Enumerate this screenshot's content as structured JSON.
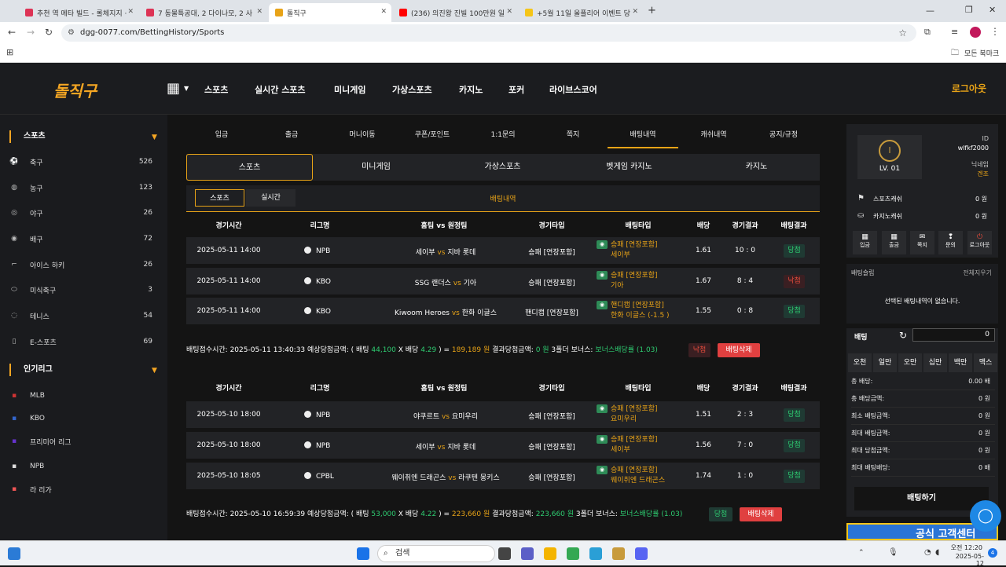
{
  "browser": {
    "tabs": [
      {
        "title": "추천 역 메타 빌드 - 롤체지지 ·",
        "color": "#d35"
      },
      {
        "title": "7 동물특공대, 2 다이나모, 2 사",
        "color": "#d35"
      },
      {
        "title": "돌직구",
        "color": "#e8a317"
      },
      {
        "title": "(236) 의진왕 진빌 100만원 일",
        "color": "#f00"
      },
      {
        "title": "+5월 11일 올플리어 이벤트 당",
        "color": "#f5c518"
      }
    ],
    "new_tab": "+",
    "url": "dgg-0077.com/BettingHistory/Sports",
    "bookmarks_label": "모든 북마크"
  },
  "site": {
    "logo": "돌직구",
    "nav": [
      "스포츠",
      "실시간 스포츠",
      "미니게임",
      "가상스포츠",
      "카지노",
      "포커",
      "라이브스코어"
    ],
    "logout": "로그아웃"
  },
  "sidebar": {
    "sports_head": "스포츠",
    "sports": [
      {
        "label": "축구",
        "count": "526",
        "icon": "⚽"
      },
      {
        "label": "농구",
        "count": "123",
        "icon": "🏀"
      },
      {
        "label": "야구",
        "count": "26",
        "icon": "⚾"
      },
      {
        "label": "배구",
        "count": "72",
        "icon": "🏐"
      },
      {
        "label": "아이스 하키",
        "count": "26",
        "icon": "🏒"
      },
      {
        "label": "미식축구",
        "count": "3",
        "icon": "🏈"
      },
      {
        "label": "테니스",
        "count": "54",
        "icon": "🎾"
      },
      {
        "label": "E-스포츠",
        "count": "69",
        "icon": "🖱"
      }
    ],
    "leagues_head": "인기리그",
    "leagues": [
      {
        "label": "MLB"
      },
      {
        "label": "KBO"
      },
      {
        "label": "프리미어 리그"
      },
      {
        "label": "NPB"
      },
      {
        "label": "라 리가"
      }
    ]
  },
  "main": {
    "menu": [
      "입금",
      "출금",
      "머니이동",
      "쿠폰/포인트",
      "1:1문의",
      "쪽지",
      "배팅내역",
      "캐쉬내역",
      "공지/규정"
    ],
    "categories": [
      "스포츠",
      "미니게임",
      "가상스포츠",
      "벳게임 카지노",
      "카지노"
    ],
    "sub_tabs": [
      "스포츠",
      "실시간"
    ],
    "sub_title": "배팅내역",
    "headers": [
      "경기시간",
      "리그명",
      "홈팀 vs 원정팀",
      "경기타입",
      "배팅타입",
      "배당",
      "경기결과",
      "배팅결과"
    ],
    "groups": [
      {
        "rows": [
          {
            "time": "2025-05-11 14:00",
            "league": "NPB",
            "home": "세이부",
            "vs": "vs",
            "away": "지바 롯데",
            "type": "승패 [연장포함]",
            "btype": "승패 [연장포함]",
            "bpick": "세이부",
            "odds": "1.61",
            "score": "10 : 0",
            "result": "당첨",
            "win": true
          },
          {
            "time": "2025-05-11 14:00",
            "league": "KBO",
            "home": "SSG 랜더스",
            "vs": "vs",
            "away": "기아",
            "type": "승패 [연장포함]",
            "btype": "승패 [연장포함]",
            "bpick": "기아",
            "odds": "1.67",
            "score": "8 : 4",
            "result": "낙첨",
            "win": false
          },
          {
            "time": "2025-05-11 14:00",
            "league": "KBO",
            "home": "Kiwoom Heroes",
            "vs": "vs",
            "away": "한화 이글스",
            "type": "핸디캡 [연장포함]",
            "btype": "핸디캡 [연장포함]",
            "bpick": "한화 이글스 (-1.5 )",
            "odds": "1.55",
            "score": "0 : 8",
            "result": "당첨",
            "win": true
          }
        ],
        "summary": {
          "prefix": "배팅접수시간: 2025-05-11 13:40:33  예상당첨금액: ( 배팅 ",
          "bet": "44,100",
          "x": " X 배당 ",
          "odds": "4.29",
          "eq": " ) = ",
          "expected": "189,189 원",
          "result_label": "  결과당첨금액: ",
          "result_amt": "0 원",
          "bonus_label": "  3폴더 보너스: ",
          "bonus": "보너스배당률 (1.03)",
          "status": "낙첨",
          "delete": "배팅삭제"
        }
      },
      {
        "rows": [
          {
            "time": "2025-05-10 18:00",
            "league": "NPB",
            "home": "야쿠르트",
            "vs": "vs",
            "away": "요미우리",
            "type": "승패 [연장포함]",
            "btype": "승패 [연장포함]",
            "bpick": "요미우리",
            "odds": "1.51",
            "score": "2 : 3",
            "result": "당첨",
            "win": true
          },
          {
            "time": "2025-05-10 18:00",
            "league": "NPB",
            "home": "세이부",
            "vs": "vs",
            "away": "지바 롯데",
            "type": "승패 [연장포함]",
            "btype": "승패 [연장포함]",
            "bpick": "세이부",
            "odds": "1.56",
            "score": "7 : 0",
            "result": "당첨",
            "win": true
          },
          {
            "time": "2025-05-10 18:05",
            "league": "CPBL",
            "home": "웨이취엔 드래곤스",
            "vs": "vs",
            "away": "라쿠텐 몽키스",
            "type": "승패 [연장포함]",
            "btype": "승패 [연장포함]",
            "bpick": "웨이취엔 드래곤스",
            "odds": "1.74",
            "score": "1 : 0",
            "result": "당첨",
            "win": true
          }
        ],
        "summary": {
          "prefix": "배팅접수시간: 2025-05-10 16:59:39  예상당첨금액: ( 배팅 ",
          "bet": "53,000",
          "x": " X 배당 ",
          "odds": "4.22",
          "eq": " ) = ",
          "expected": "223,660 원",
          "result_label": "  결과당첨금액: ",
          "result_amt": "223,660 원",
          "bonus_label": "  3폴더 보너스: ",
          "bonus": "보너스배당률 (1.03)",
          "status": "당첨",
          "delete": "배팅삭제"
        }
      }
    ]
  },
  "right": {
    "lv": "LV. 01",
    "id_label": "ID",
    "id_value": "wlfkf2000",
    "nick_label": "닉네임",
    "nick_value": "겐조",
    "sports_cash_label": "스포츠캐쉬",
    "sports_cash": "0 원",
    "casino_cash_label": "카지노캐쉬",
    "casino_cash": "0 원",
    "quick": [
      {
        "label": "입금",
        "icon": "▦"
      },
      {
        "label": "출금",
        "icon": "▦"
      },
      {
        "label": "쪽지",
        "icon": "✉"
      },
      {
        "label": "문의",
        "icon": "❢"
      },
      {
        "label": "로그아웃",
        "icon": "⏻"
      }
    ],
    "slip_title": "배팅슬립",
    "slip_clear": "전체지우기",
    "slip_empty": "선택된 배팅내역이 없습니다.",
    "bet_label": "배팅",
    "bet_amount": "0",
    "amounts": [
      "오천",
      "일만",
      "오만",
      "십만",
      "백만",
      "맥스"
    ],
    "info": [
      {
        "label": "총 배당:",
        "value": "0.00 배"
      },
      {
        "label": "총 배당금액:",
        "value": "0 원"
      },
      {
        "label": "최소 배팅금액:",
        "value": "0 원"
      },
      {
        "label": "최대 배팅금액:",
        "value": "0 원"
      },
      {
        "label": "최대 당첨금액:",
        "value": "0 원"
      },
      {
        "label": "최대 배팅배당:",
        "value": "0 배"
      }
    ],
    "place_bet": "배팅하기",
    "banner": "공식 고객센터"
  },
  "taskbar": {
    "search": "검색",
    "time": "오전 12:20",
    "date": "2025-05-12",
    "notif": "4"
  }
}
